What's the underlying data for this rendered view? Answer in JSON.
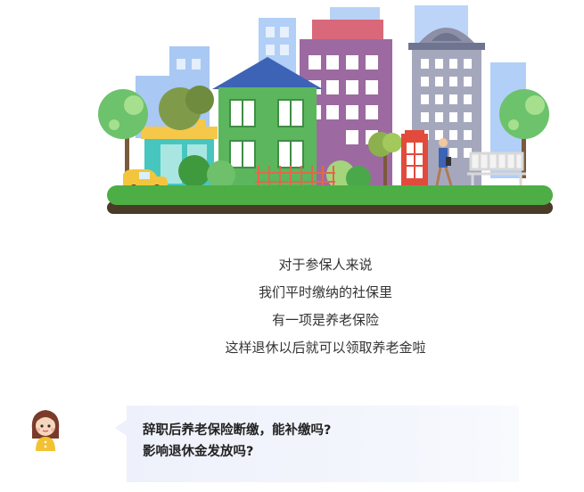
{
  "intro_lines": [
    "对于参保人来说",
    "我们平时缴纳的社保里",
    "有一项是养老保险",
    "这样退休以后就可以领取养老金啦"
  ],
  "question": {
    "line1": "辞职后养老保险断缴，能补缴吗?",
    "line2": "影响退休金发放吗?"
  },
  "colors": {
    "grass": "#4cae45",
    "soil": "#4a3a28",
    "bubble": "#eef1fb"
  }
}
